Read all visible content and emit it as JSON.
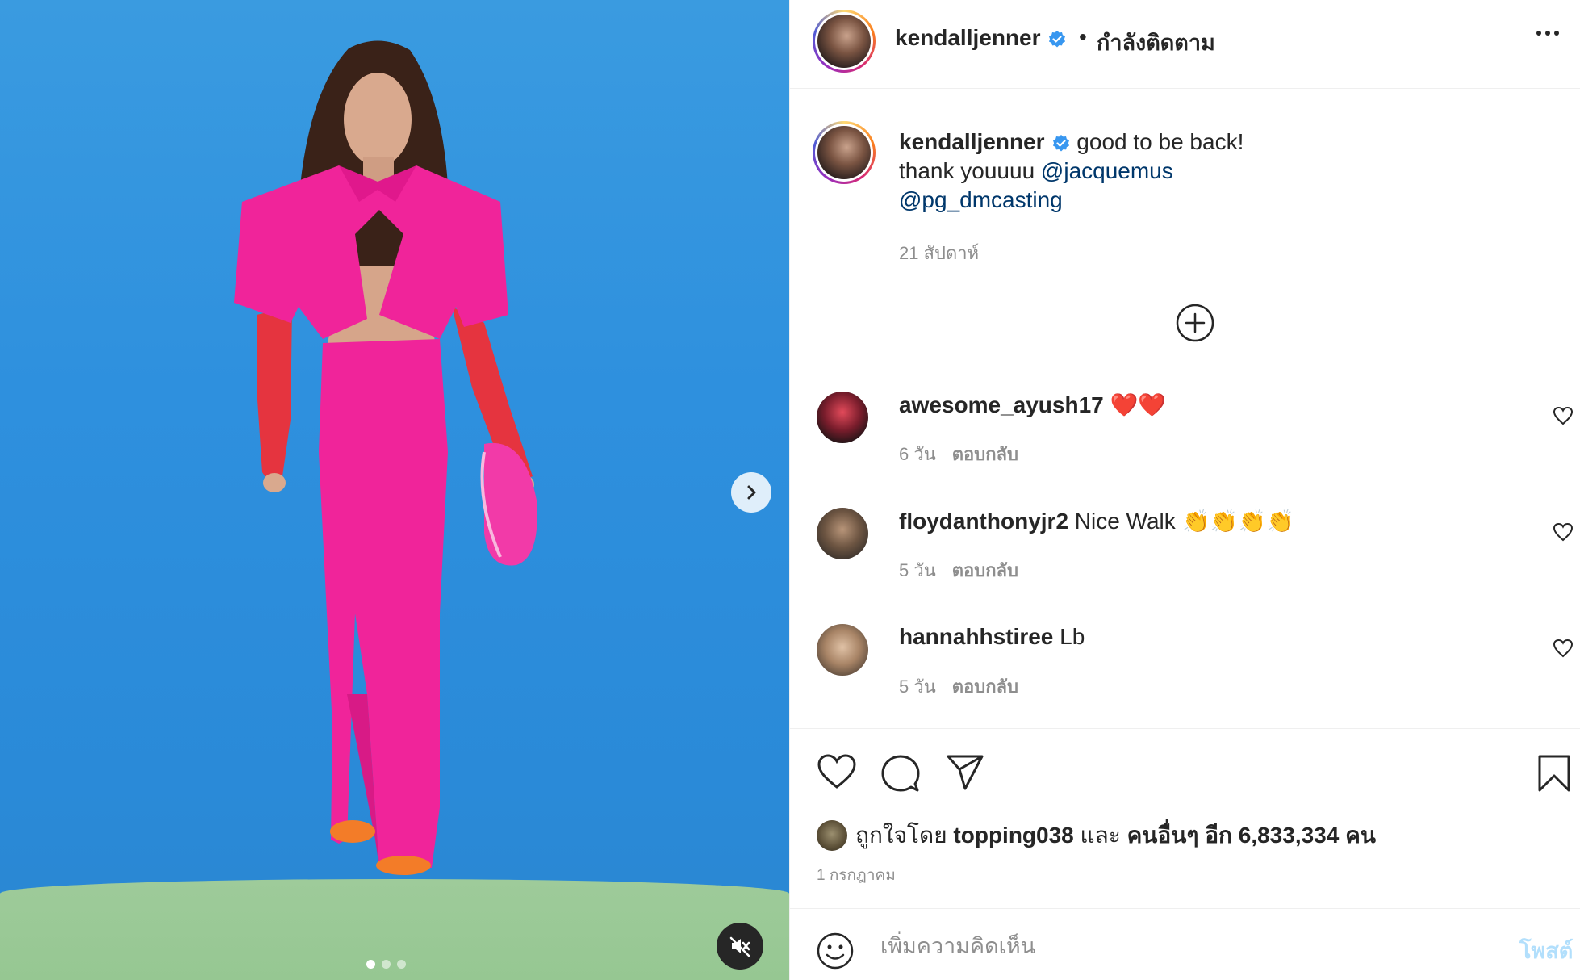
{
  "post": {
    "username": "kendalljenner",
    "follow_status": "กำลังติดตาม",
    "verified": true,
    "caption": {
      "text_1": "good to be back!",
      "text_2": "thank youuuu",
      "mention_1": "@jacquemus",
      "mention_2": "@pg_dmcasting"
    },
    "caption_time": "21 สัปดาห์"
  },
  "comments": [
    {
      "username": "awesome_ayush17",
      "text": "❤️❤️",
      "time": "6 วัน",
      "reply_label": "ตอบกลับ"
    },
    {
      "username": "floydanthonyjr2",
      "text": "Nice Walk 👏👏👏👏",
      "time": "5 วัน",
      "reply_label": "ตอบกลับ"
    },
    {
      "username": "hannahhstiree",
      "text": "Lb",
      "time": "5 วัน",
      "reply_label": "ตอบกลับ"
    }
  ],
  "likes": {
    "prefix": "ถูกใจโดย",
    "first_user": "topping038",
    "conjunction": "และ",
    "others": "คนอื่นๆ อีก 6,833,334 คน"
  },
  "post_date": "1 กรกฎาคม",
  "comment_box": {
    "placeholder": "เพิ่มความคิดเห็น",
    "post_label": "โพสต์"
  },
  "media": {
    "slide_count": 3,
    "active_slide": 1
  },
  "colors": {
    "accent_blue": "#0095f6",
    "mention": "#00376b",
    "muted": "#8e8e8e",
    "post_disabled": "#b2dffc"
  },
  "icons": {
    "verified": "verified-badge-icon",
    "more": "more-options-icon",
    "load_more": "plus-circle-icon",
    "like": "heart-icon",
    "comment": "comment-bubble-icon",
    "share": "paper-plane-icon",
    "save": "bookmark-icon",
    "emoji": "smiley-icon",
    "next": "chevron-right-icon",
    "mute": "speaker-muted-icon"
  }
}
